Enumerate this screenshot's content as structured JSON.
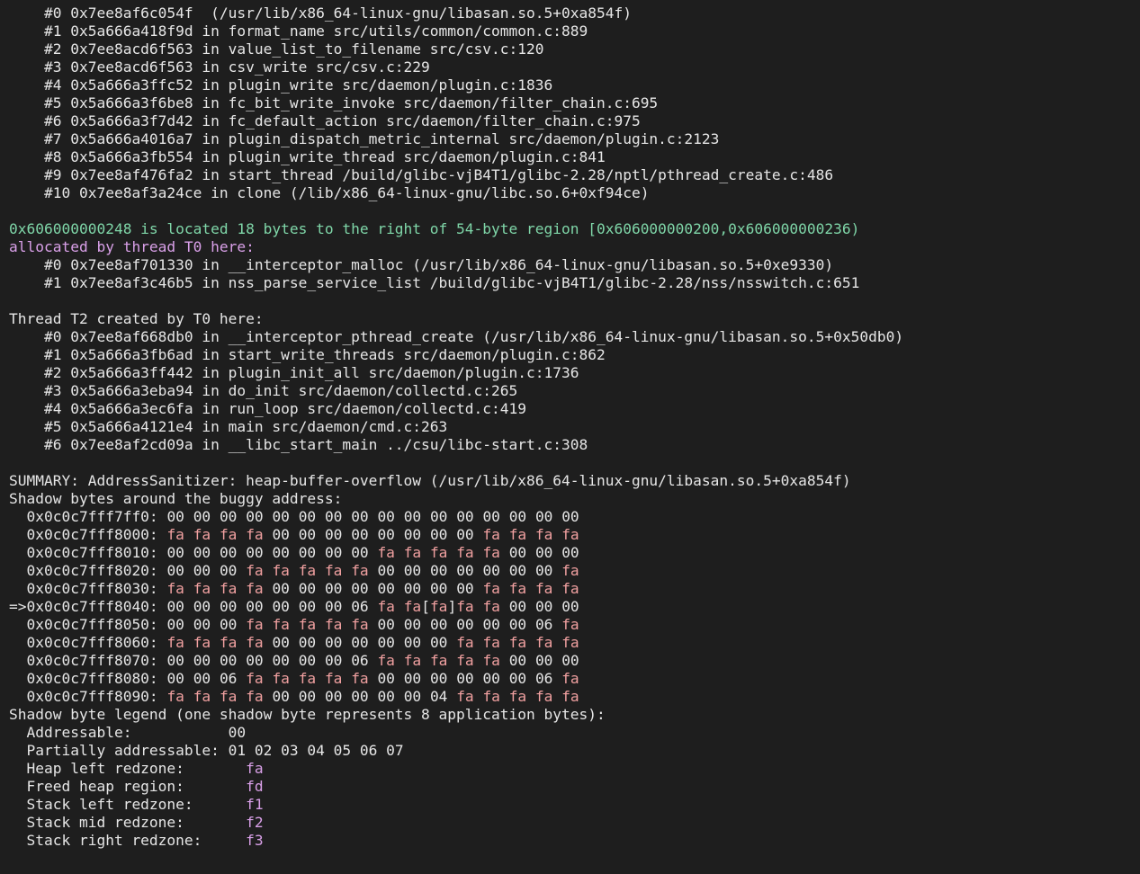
{
  "colors": {
    "background": "#1e1e1e",
    "text": "#e6e6e6",
    "location_line": "#7fd6a8",
    "allocated_line": "#d9a0e8",
    "redzone_byte": "#f0a0a0",
    "legend_value": "#d9a0e8"
  },
  "frames1": [
    "    #0 0x7ee8af6c054f  (/usr/lib/x86_64-linux-gnu/libasan.so.5+0xa854f)",
    "    #1 0x5a666a418f9d in format_name src/utils/common/common.c:889",
    "    #2 0x7ee8acd6f563 in value_list_to_filename src/csv.c:120",
    "    #3 0x7ee8acd6f563 in csv_write src/csv.c:229",
    "    #4 0x5a666a3ffc52 in plugin_write src/daemon/plugin.c:1836",
    "    #5 0x5a666a3f6be8 in fc_bit_write_invoke src/daemon/filter_chain.c:695",
    "    #6 0x5a666a3f7d42 in fc_default_action src/daemon/filter_chain.c:975",
    "    #7 0x5a666a4016a7 in plugin_dispatch_metric_internal src/daemon/plugin.c:2123",
    "    #8 0x5a666a3fb554 in plugin_write_thread src/daemon/plugin.c:841",
    "    #9 0x7ee8af476fa2 in start_thread /build/glibc-vjB4T1/glibc-2.28/nptl/pthread_create.c:486",
    "    #10 0x7ee8af3a24ce in clone (/lib/x86_64-linux-gnu/libc.so.6+0xf94ce)"
  ],
  "location_line": "0x606000000248 is located 18 bytes to the right of 54-byte region [0x606000000200,0x606000000236)",
  "allocated_header": "allocated by thread T0 here:",
  "frames_alloc": [
    "    #0 0x7ee8af701330 in __interceptor_malloc (/usr/lib/x86_64-linux-gnu/libasan.so.5+0xe9330)",
    "    #1 0x7ee8af3c46b5 in nss_parse_service_list /build/glibc-vjB4T1/glibc-2.28/nss/nsswitch.c:651"
  ],
  "thread_header": "Thread T2 created by T0 here:",
  "frames_thread": [
    "    #0 0x7ee8af668db0 in __interceptor_pthread_create (/usr/lib/x86_64-linux-gnu/libasan.so.5+0x50db0)",
    "    #1 0x5a666a3fb6ad in start_write_threads src/daemon/plugin.c:862",
    "    #2 0x5a666a3ff442 in plugin_init_all src/daemon/plugin.c:1736",
    "    #3 0x5a666a3eba94 in do_init src/daemon/collectd.c:265",
    "    #4 0x5a666a3ec6fa in run_loop src/daemon/collectd.c:419",
    "    #5 0x5a666a4121e4 in main src/daemon/cmd.c:263",
    "    #6 0x7ee8af2cd09a in __libc_start_main ../csu/libc-start.c:308"
  ],
  "summary": "SUMMARY: AddressSanitizer: heap-buffer-overflow (/usr/lib/x86_64-linux-gnu/libasan.so.5+0xa854f)",
  "shadow_header": "Shadow bytes around the buggy address:",
  "shadow_rows": [
    {
      "prefix": "  0x0c0c7fff7ff0:",
      "bytes": [
        "00",
        "00",
        "00",
        "00",
        "00",
        "00",
        "00",
        "00",
        "00",
        "00",
        "00",
        "00",
        "00",
        "00",
        "00",
        "00"
      ]
    },
    {
      "prefix": "  0x0c0c7fff8000:",
      "bytes": [
        "fa",
        "fa",
        "fa",
        "fa",
        "00",
        "00",
        "00",
        "00",
        "00",
        "00",
        "00",
        "00",
        "fa",
        "fa",
        "fa",
        "fa"
      ]
    },
    {
      "prefix": "  0x0c0c7fff8010:",
      "bytes": [
        "00",
        "00",
        "00",
        "00",
        "00",
        "00",
        "00",
        "00",
        "fa",
        "fa",
        "fa",
        "fa",
        "fa",
        "00",
        "00",
        "00"
      ]
    },
    {
      "prefix": "  0x0c0c7fff8020:",
      "bytes": [
        "00",
        "00",
        "00",
        "fa",
        "fa",
        "fa",
        "fa",
        "fa",
        "00",
        "00",
        "00",
        "00",
        "00",
        "00",
        "00",
        "fa"
      ]
    },
    {
      "prefix": "  0x0c0c7fff8030:",
      "bytes": [
        "fa",
        "fa",
        "fa",
        "fa",
        "00",
        "00",
        "00",
        "00",
        "00",
        "00",
        "00",
        "00",
        "fa",
        "fa",
        "fa",
        "fa"
      ]
    },
    {
      "prefix": "=>0x0c0c7fff8040:",
      "bytes": [
        "00",
        "00",
        "00",
        "00",
        "00",
        "00",
        "00",
        "06",
        "fa",
        "fa",
        "fa",
        "fa",
        "fa",
        "00",
        "00",
        "00"
      ],
      "highlight": 10
    },
    {
      "prefix": "  0x0c0c7fff8050:",
      "bytes": [
        "00",
        "00",
        "00",
        "fa",
        "fa",
        "fa",
        "fa",
        "fa",
        "00",
        "00",
        "00",
        "00",
        "00",
        "00",
        "06",
        "fa"
      ]
    },
    {
      "prefix": "  0x0c0c7fff8060:",
      "bytes": [
        "fa",
        "fa",
        "fa",
        "fa",
        "00",
        "00",
        "00",
        "00",
        "00",
        "00",
        "00",
        "fa",
        "fa",
        "fa",
        "fa",
        "fa"
      ]
    },
    {
      "prefix": "  0x0c0c7fff8070:",
      "bytes": [
        "00",
        "00",
        "00",
        "00",
        "00",
        "00",
        "00",
        "06",
        "fa",
        "fa",
        "fa",
        "fa",
        "fa",
        "00",
        "00",
        "00"
      ]
    },
    {
      "prefix": "  0x0c0c7fff8080:",
      "bytes": [
        "00",
        "00",
        "06",
        "fa",
        "fa",
        "fa",
        "fa",
        "fa",
        "00",
        "00",
        "00",
        "00",
        "00",
        "00",
        "06",
        "fa"
      ]
    },
    {
      "prefix": "  0x0c0c7fff8090:",
      "bytes": [
        "fa",
        "fa",
        "fa",
        "fa",
        "00",
        "00",
        "00",
        "00",
        "00",
        "00",
        "04",
        "fa",
        "fa",
        "fa",
        "fa",
        "fa"
      ]
    }
  ],
  "legend_header": "Shadow byte legend (one shadow byte represents 8 application bytes):",
  "legend": [
    {
      "label": "  Addressable:           ",
      "value": "00",
      "colored": false
    },
    {
      "label": "  Partially addressable: ",
      "value": "01 02 03 04 05 06 07",
      "colored": false
    },
    {
      "label": "  Heap left redzone:       ",
      "value": "fa",
      "colored": true
    },
    {
      "label": "  Freed heap region:       ",
      "value": "fd",
      "colored": true
    },
    {
      "label": "  Stack left redzone:      ",
      "value": "f1",
      "colored": true
    },
    {
      "label": "  Stack mid redzone:       ",
      "value": "f2",
      "colored": true
    },
    {
      "label": "  Stack right redzone:     ",
      "value": "f3",
      "colored": true
    }
  ]
}
